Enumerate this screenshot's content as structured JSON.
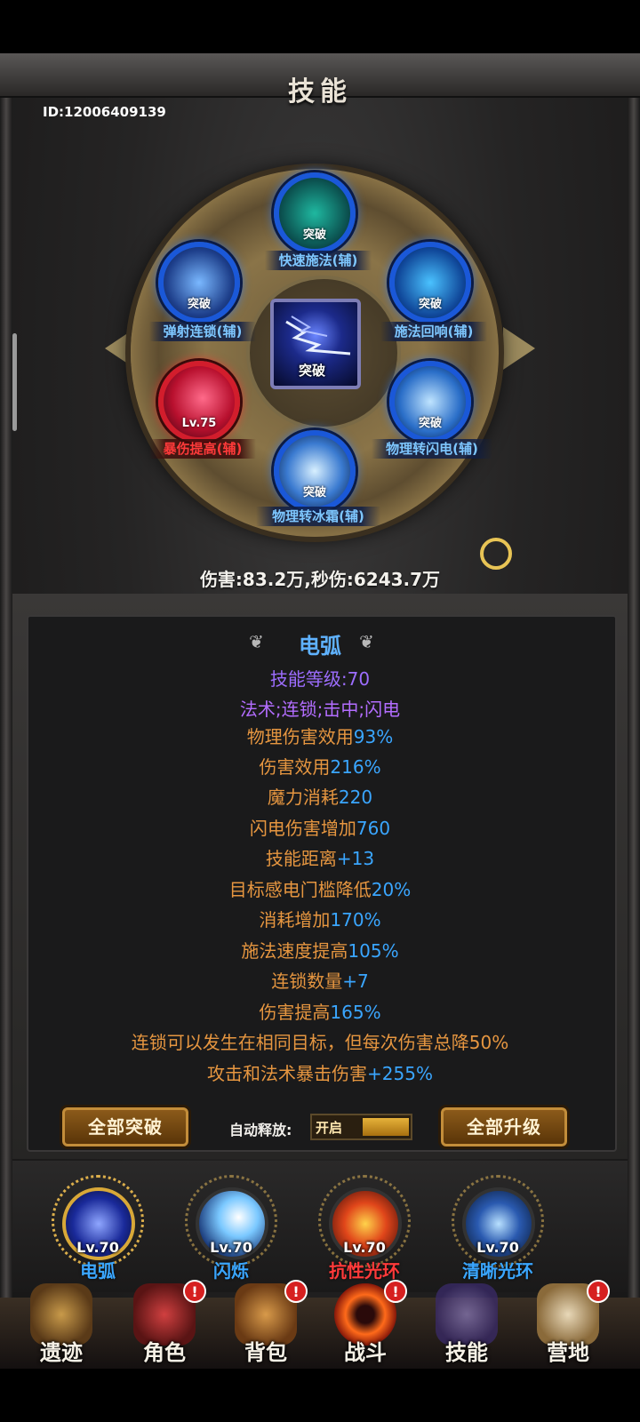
{
  "header": {
    "title": "技能",
    "player_id": "ID:12006409139"
  },
  "wheel": {
    "center": {
      "tag": "突破"
    },
    "nodes": [
      {
        "tag": "突破",
        "label": "快速施法(辅)"
      },
      {
        "tag": "突破",
        "label": "弹射连锁(辅)"
      },
      {
        "tag": "突破",
        "label": "施法回响(辅)"
      },
      {
        "tag": "Lv.75",
        "label": "暴伤提高(辅)"
      },
      {
        "tag": "突破",
        "label": "物理转闪电(辅)"
      },
      {
        "tag": "突破",
        "label": "物理转冰霜(辅)"
      }
    ]
  },
  "damage_line": "伤害:83.2万,秒伤:6243.7万",
  "detail": {
    "name": "电弧",
    "level": "技能等级:70",
    "tags": "法术;连锁;击中;闪电",
    "stats": [
      {
        "label": "物理伤害效用",
        "value": "93%"
      },
      {
        "label": "伤害效用",
        "value": "216%"
      },
      {
        "label": "魔力消耗",
        "value": "220"
      },
      {
        "label": "闪电伤害增加",
        "value": "760"
      },
      {
        "label": "技能距离",
        "value": "+13"
      },
      {
        "label": "目标感电门槛降低",
        "value": "20%"
      },
      {
        "label": "消耗增加",
        "value": "170%"
      },
      {
        "label": "施法速度提高",
        "value": "105%"
      },
      {
        "label": "连锁数量",
        "value": "+7"
      },
      {
        "label": "伤害提高",
        "value": "165%"
      },
      {
        "label": "连锁可以发生在相同目标，但每次伤害总降50%",
        "value": ""
      },
      {
        "label": "攻击和法术暴击伤害",
        "value": "+255%"
      }
    ]
  },
  "actions": {
    "break_all": "全部突破",
    "auto_label": "自动释放:",
    "auto_state": "开启",
    "upgrade_all": "全部升级"
  },
  "skillbar": [
    {
      "lv": "Lv.70",
      "name": "电弧",
      "color": "#3aa6ff"
    },
    {
      "lv": "Lv.70",
      "name": "闪烁",
      "color": "#3aa6ff"
    },
    {
      "lv": "Lv.70",
      "name": "抗性光环",
      "color": "#ff3a3a"
    },
    {
      "lv": "Lv.70",
      "name": "清晰光环",
      "color": "#3aa6ff"
    }
  ],
  "nav": [
    {
      "label": "遗迹",
      "badge": ""
    },
    {
      "label": "角色",
      "badge": "!"
    },
    {
      "label": "背包",
      "badge": "!"
    },
    {
      "label": "战斗",
      "badge": "!"
    },
    {
      "label": "技能",
      "badge": ""
    },
    {
      "label": "营地",
      "badge": "!"
    }
  ]
}
